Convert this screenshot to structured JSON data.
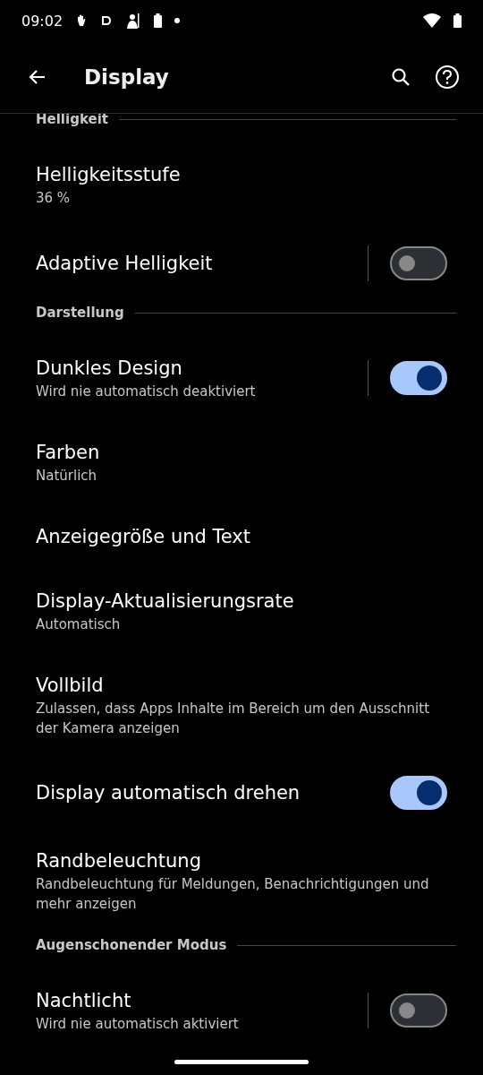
{
  "status_bar": {
    "time": "09:02"
  },
  "app_bar": {
    "title": "Display"
  },
  "items": [
    {
      "kind": "header",
      "title": "Helligkeit"
    },
    {
      "kind": "item",
      "title": "Helligkeitsstufe",
      "subtitle": "36 %"
    },
    {
      "kind": "toggle",
      "title": "Adaptive Helligkeit",
      "on": false,
      "divider": true
    },
    {
      "kind": "header",
      "title": "Darstellung"
    },
    {
      "kind": "toggle",
      "title": "Dunkles Design",
      "subtitle": "Wird nie automatisch deaktiviert",
      "on": true,
      "divider": true
    },
    {
      "kind": "item",
      "title": "Farben",
      "subtitle": "Natürlich"
    },
    {
      "kind": "item",
      "title": "Anzeigegröße und Text"
    },
    {
      "kind": "item",
      "title": "Display-Aktualisierungsrate",
      "subtitle": "Automatisch"
    },
    {
      "kind": "item",
      "title": "Vollbild",
      "subtitle": "Zulassen, dass Apps Inhalte im Bereich um den Ausschnitt der Kamera anzeigen"
    },
    {
      "kind": "toggle",
      "title": "Display automatisch drehen",
      "on": true,
      "divider": false
    },
    {
      "kind": "item",
      "title": "Randbeleuchtung",
      "subtitle": "Randbeleuchtung für Meldungen, Benachrichtigungen und mehr anzeigen"
    },
    {
      "kind": "header",
      "title": "Augenschonender Modus"
    },
    {
      "kind": "toggle",
      "title": "Nachtlicht",
      "subtitle": "Wird nie automatisch aktiviert",
      "on": false,
      "divider": true
    }
  ]
}
